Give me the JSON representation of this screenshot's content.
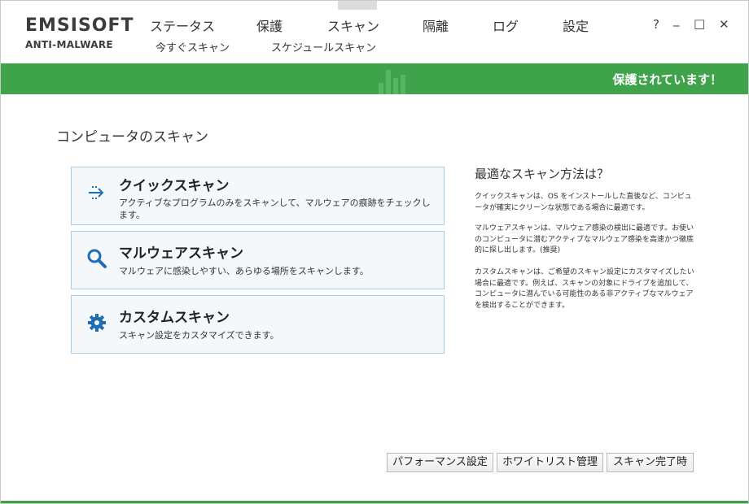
{
  "brand": {
    "line1": "EMSISOFT",
    "line2": "ANTI-MALWARE"
  },
  "nav": {
    "tabs": [
      "ステータス",
      "保護",
      "スキャン",
      "隔離",
      "ログ",
      "設定"
    ],
    "active_tab": "スキャン",
    "subtabs": [
      "今すぐスキャン",
      "スケジュールスキャン"
    ]
  },
  "window_controls": {
    "help": "?",
    "minimize": "_",
    "maximize": "□",
    "close": "✕"
  },
  "status_bar": {
    "text": "保護されています！",
    "color": "#3ea34a"
  },
  "page": {
    "title": "コンピュータのスキャン"
  },
  "scan_options": [
    {
      "icon": "quick-scan-arrows-icon",
      "title": "クイックスキャン",
      "description": "アクティブなプログラムのみをスキャンして、マルウェアの痕跡をチェックします。"
    },
    {
      "icon": "magnifier-icon",
      "title": "マルウェアスキャン",
      "description": "マルウェアに感染しやすい、あらゆる場所をスキャンします。"
    },
    {
      "icon": "gear-icon",
      "title": "カスタムスキャン",
      "description": "スキャン設定をカスタマイズできます。"
    }
  ],
  "side": {
    "title": "最適なスキャン方法は？",
    "paragraphs": [
      "クイックスキャンは、OS をインストールした直後など、コンピュータが確実にクリーンな状態である場合に最適です。",
      "マルウェアスキャンは、マルウェア感染の検出に最適です。お使いのコンピュータに潜むアクティブなマルウェア感染を高速かつ徹底的に探し出します。(推奨)",
      "カスタムスキャンは、ご希望のスキャン設定にカスタマイズしたい場合に最適です。例えば、スキャンの対象にドライブを追加して、コンピュータに潜んでいる可能性のある非アクティブなマルウェアを検出することができます。"
    ]
  },
  "buttons": {
    "performance": "パフォーマンス設定",
    "whitelist": "ホワイトリスト管理",
    "on_complete": "スキャン完了時"
  },
  "colors": {
    "accent_green": "#3ea34a",
    "card_border": "#a8cde3",
    "icon_blue": "#1f6db3"
  }
}
